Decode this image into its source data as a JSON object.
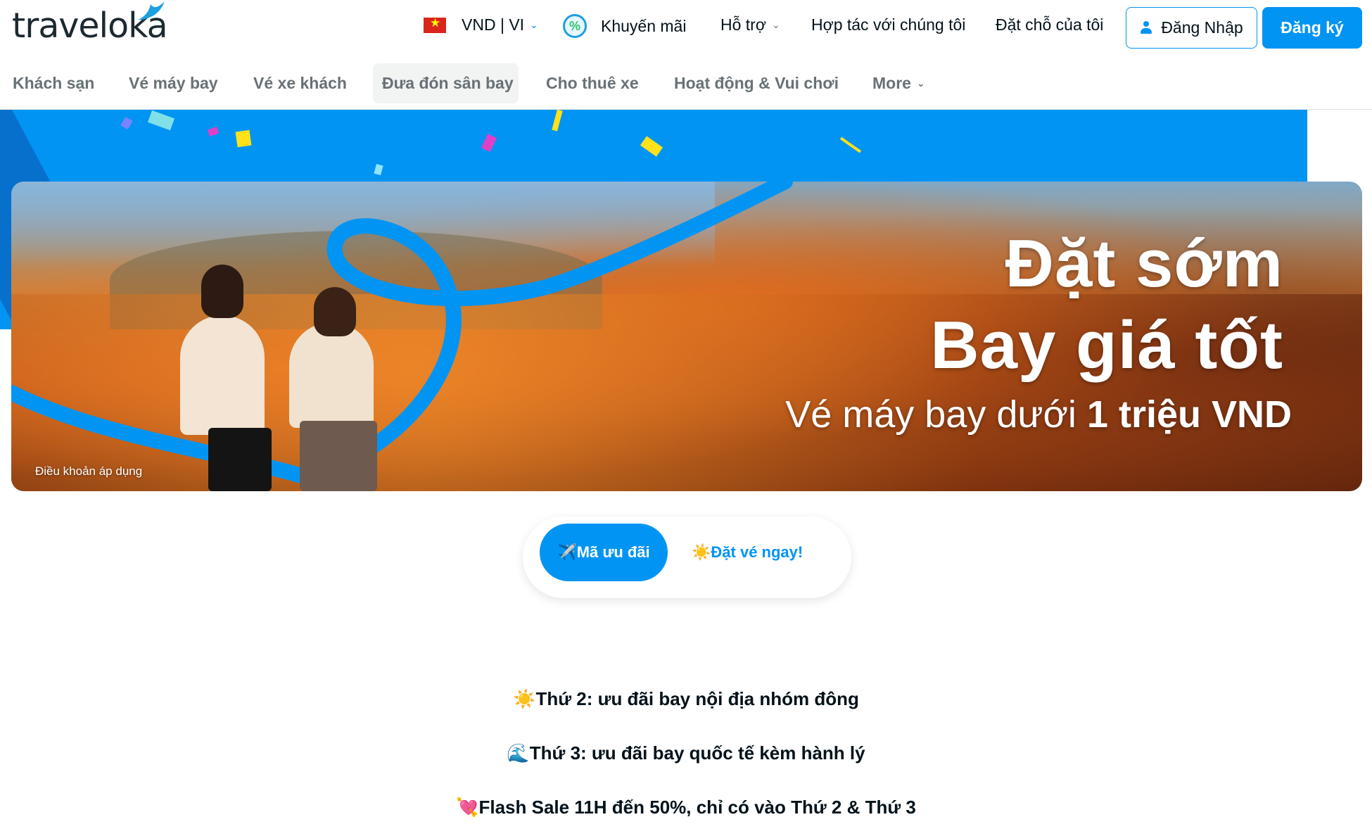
{
  "header": {
    "logo_text": "traveloka",
    "currency": "VND | VI",
    "promo_label": "Khuyến mãi",
    "support_label": "Hỗ trợ",
    "partner_label": "Hợp tác với chúng tôi",
    "bookings_label": "Đặt chỗ của tôi",
    "login_label": "Đăng Nhập",
    "signup_label": "Đăng ký"
  },
  "nav": {
    "tabs": [
      "Khách sạn",
      "Vé máy bay",
      "Vé xe khách",
      "Đưa đón sân bay",
      "Cho thuê xe",
      "Hoạt động & Vui chơi",
      "More"
    ],
    "active_index": 3
  },
  "banner": {
    "line1": "Đặt sớm",
    "line2": "Bay giá tốt",
    "line3_prefix": "Vé máy bay dưới ",
    "line3_bold": "1 triệu VND",
    "terms": "Điều khoản áp dụng"
  },
  "pills": {
    "active": "✈️Mã ưu đãi",
    "inactive": "☀️Đặt vé ngay!"
  },
  "promos": [
    "☀️Thứ 2: ưu đãi bay nội địa nhóm đông",
    "🌊Thứ 3: ưu đãi bay quốc tế kèm hành lý",
    "💘Flash Sale 11H đến 50%, chỉ có vào Thứ 2 & Thứ 3"
  ],
  "colors": {
    "brand_blue": "#0194f3",
    "dark_blue": "#0770cd",
    "text": "#03121a",
    "muted": "#687176"
  }
}
